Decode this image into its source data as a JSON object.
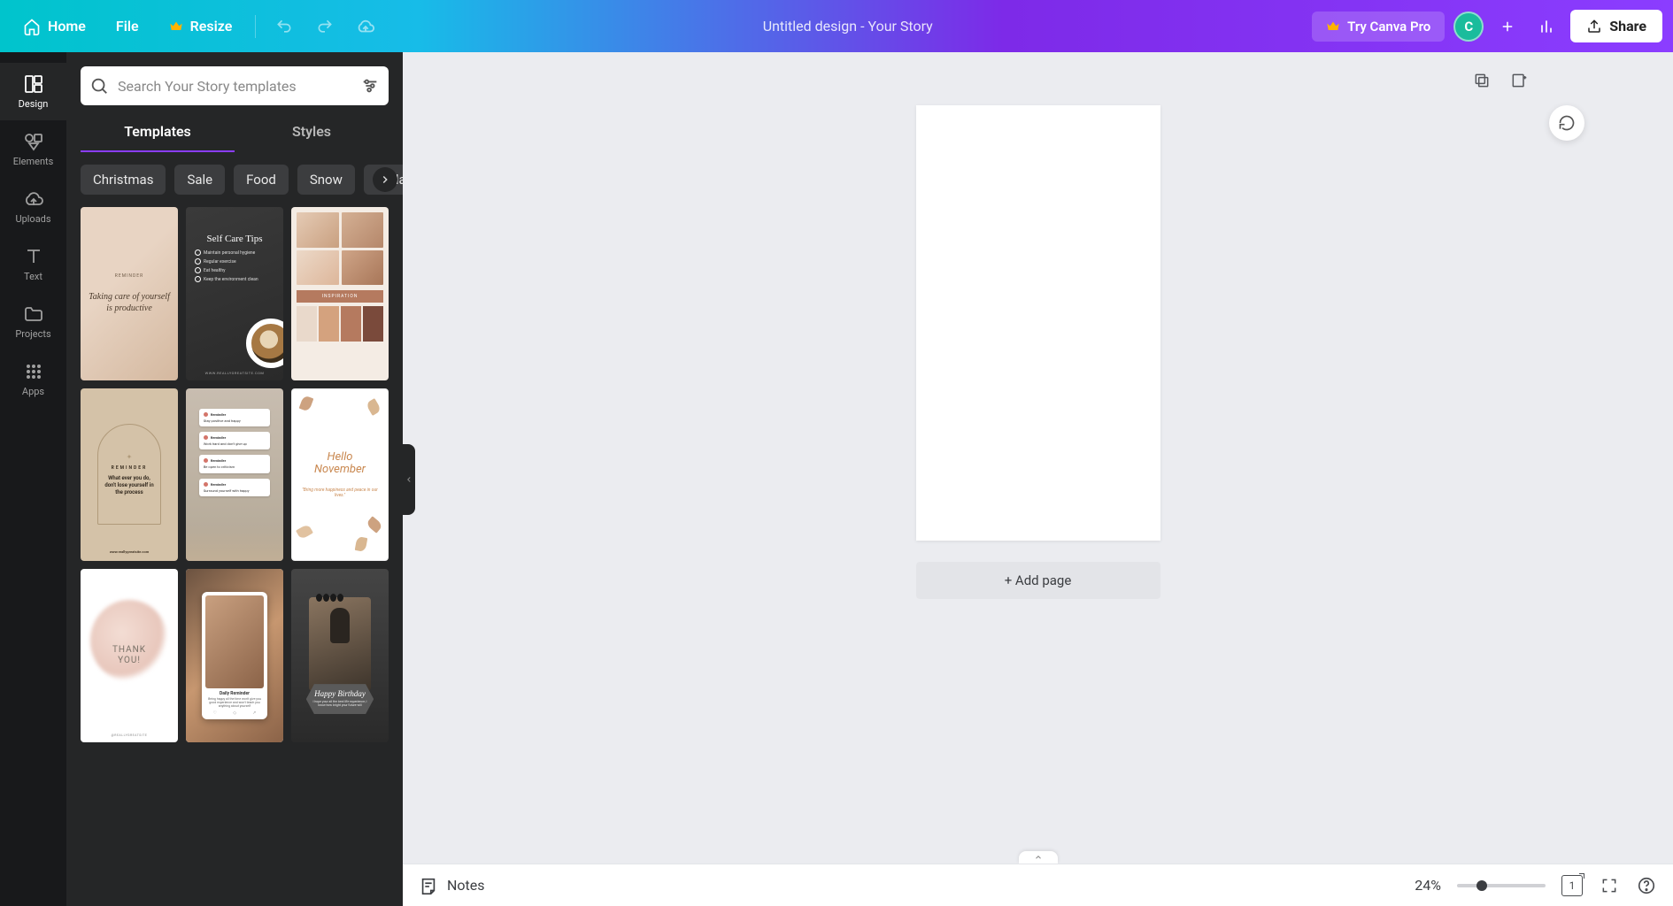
{
  "topbar": {
    "home": "Home",
    "file": "File",
    "resize": "Resize",
    "doc_title": "Untitled design - Your Story",
    "pro": "Try Canva Pro",
    "share": "Share",
    "avatar_initial": "C"
  },
  "nav": {
    "design": "Design",
    "elements": "Elements",
    "uploads": "Uploads",
    "text": "Text",
    "projects": "Projects",
    "apps": "Apps"
  },
  "search": {
    "placeholder": "Search Your Story templates"
  },
  "tabs": {
    "templates": "Templates",
    "styles": "Styles"
  },
  "chips": [
    "Christmas",
    "Sale",
    "Food",
    "Snow",
    "Collage"
  ],
  "templates": {
    "t1": {
      "label": "REMINDER",
      "text": "Taking care of yourself is productive"
    },
    "t2": {
      "title": "Self Care Tips",
      "items": [
        "Maintain personal hygiene",
        "Regular exercise",
        "Eat healthy",
        "Keep the environment clean"
      ],
      "footer": "WWW.REALLYGREATSITE.COM"
    },
    "t3": {
      "bar": "INSPIRATION"
    },
    "t4": {
      "label": "REMINDER",
      "text": "What ever you do, don't lose yourself in the process",
      "footer": "www.reallygreatsite.com"
    },
    "t5": {
      "cards": [
        "Stay positive and happy",
        "Work hard and don't give up",
        "Be open to criticism",
        "Surround yourself with happy"
      ]
    },
    "t6": {
      "title1": "Hello",
      "title2": "November",
      "sub": "\"Bring more happiness and peace in our lives.\""
    },
    "t7": {
      "line1": "THANK",
      "line2": "YOU!",
      "footer": "@REALLYGREATSITE"
    },
    "t8": {
      "title": "Daily Reminder",
      "text": "Being happy all the time won't give you good experience and won't teach you anything about yourself"
    },
    "t9": {
      "title": "Happy Birthday",
      "sub": "I hope your all the best life experience, I know how bright your future will"
    }
  },
  "canvas": {
    "add_page": "+ Add page"
  },
  "status": {
    "notes": "Notes",
    "zoom": "24%",
    "pages": "1"
  }
}
